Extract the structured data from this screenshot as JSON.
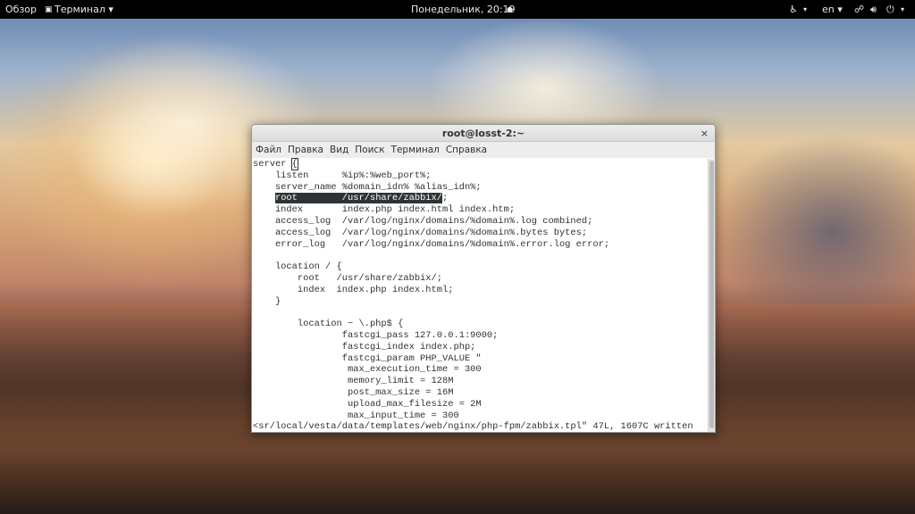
{
  "topbar": {
    "overview": "Обзор",
    "app_menu": "Терминал ▾",
    "clock": "Понедельник, 20:19",
    "lang": "en ▾",
    "accessibility": "▾",
    "power": "▾"
  },
  "window": {
    "title": "root@losst-2:~",
    "close": "×",
    "menu": [
      "Файл",
      "Правка",
      "Вид",
      "Поиск",
      "Терминал",
      "Справка"
    ]
  },
  "terminal": {
    "line0a": "server ",
    "line0cursor": "{",
    "line1": "    listen      %ip%:%web_port%;",
    "line2": "    server_name %domain_idn% %alias_idn%;",
    "line3_selected": "root        /usr/share/zabbix/",
    "line3_pre": "    ",
    "line3_post": ";",
    "line4": "    index       index.php index.html index.htm;",
    "line5": "    access_log  /var/log/nginx/domains/%domain%.log combined;",
    "line6": "    access_log  /var/log/nginx/domains/%domain%.bytes bytes;",
    "line7": "    error_log   /var/log/nginx/domains/%domain%.error.log error;",
    "line8": "",
    "line9": "    location / {",
    "line10": "        root   /usr/share/zabbix/;",
    "line11": "        index  index.php index.html;",
    "line12": "    }",
    "line13": "",
    "line14": "        location ~ \\.php$ {",
    "line15": "                fastcgi_pass 127.0.0.1:9000;",
    "line16": "                fastcgi_index index.php;",
    "line17": "                fastcgi_param PHP_VALUE \"",
    "line18": "                 max_execution_time = 300",
    "line19": "                 memory_limit = 128M",
    "line20": "                 post_max_size = 16M",
    "line21": "                 upload_max_filesize = 2M",
    "line22": "                 max_input_time = 300",
    "status": "<sr/local/vesta/data/templates/web/nginx/php-fpm/zabbix.tpl\" 47L, 1607C written"
  }
}
